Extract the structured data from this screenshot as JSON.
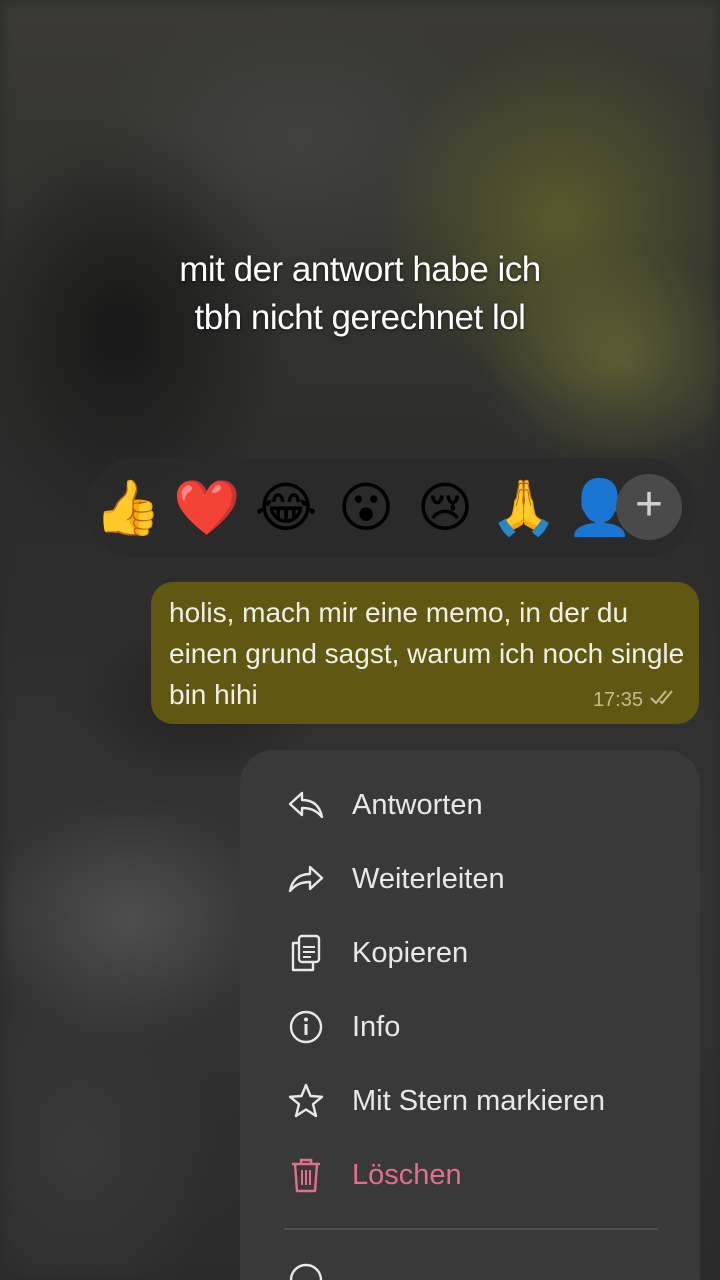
{
  "caption": {
    "line1": "mit der antwort habe ich",
    "line2": "tbh nicht gerechnet lol"
  },
  "reactions": {
    "emojis": [
      "👍",
      "❤️",
      "😂",
      "😮",
      "😢",
      "🙏",
      "👤"
    ],
    "add_icon": "plus-icon",
    "add_label": "+"
  },
  "message": {
    "text": "holis, mach mir eine memo, in der du einen grund sagst, warum ich noch single bin hihi",
    "time": "17:35",
    "status_icon": "double-check-icon",
    "bubble_color": "#605812"
  },
  "menu": {
    "items": [
      {
        "label": "Antworten",
        "icon": "reply-icon"
      },
      {
        "label": "Weiterleiten",
        "icon": "forward-icon"
      },
      {
        "label": "Kopieren",
        "icon": "copy-icon"
      },
      {
        "label": "Info",
        "icon": "info-icon"
      },
      {
        "label": "Mit Stern markieren",
        "icon": "star-icon"
      },
      {
        "label": "Löschen",
        "icon": "trash-icon",
        "color": "#e0708c"
      }
    ]
  }
}
